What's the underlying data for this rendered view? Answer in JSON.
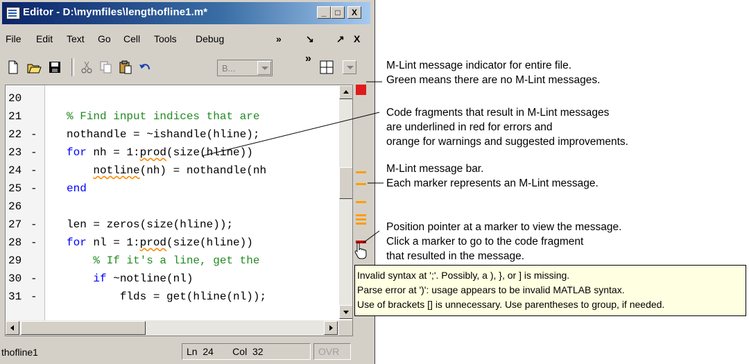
{
  "window": {
    "title": "Editor - D:\\mymfiles\\lengthofline1.m*",
    "buttons": {
      "minimize": "_",
      "maximize": "□",
      "close": "X"
    }
  },
  "menubar": {
    "items": [
      "File",
      "Edit",
      "Text",
      "Go",
      "Cell",
      "Tools",
      "Debug"
    ],
    "overflow": "»",
    "dock": "↘",
    "undock": "↗",
    "close": "X"
  },
  "toolbar": {
    "icons": [
      "new-file-icon",
      "open-folder-icon",
      "save-icon",
      "cut-icon",
      "copy-icon",
      "paste-icon",
      "undo-icon"
    ],
    "stack_combo": "B...",
    "overflow": "»",
    "layout_icon": "grid-icon"
  },
  "editor": {
    "lines": [
      {
        "num": "20",
        "bp": "",
        "text": ""
      },
      {
        "num": "21",
        "bp": "",
        "text": "% Find input indices that are"
      },
      {
        "num": "22",
        "bp": "-",
        "text": "nothandle = ~ishandle(hline);"
      },
      {
        "num": "23",
        "bp": "-",
        "kw": "for",
        "text": " nh = 1:prod(size(hline))"
      },
      {
        "num": "24",
        "bp": "-",
        "text": "    notline(nh) = nothandle(nh"
      },
      {
        "num": "25",
        "bp": "-",
        "kw": "end",
        "text": ""
      },
      {
        "num": "26",
        "bp": "",
        "text": ""
      },
      {
        "num": "27",
        "bp": "-",
        "text": "len = zeros(size(hline));"
      },
      {
        "num": "28",
        "bp": "-",
        "kw": "for",
        "text": " nl = 1:prod(size(hline))"
      },
      {
        "num": "29",
        "bp": "",
        "text": "    % If it's a line, get the"
      },
      {
        "num": "30",
        "bp": "-",
        "kw": "    if",
        "text": " ~notline(nl)"
      },
      {
        "num": "31",
        "bp": "-",
        "text": "        flds = get(hline(nl));"
      }
    ]
  },
  "mlint": {
    "indicator_color": "#e01b1b",
    "marker_color": "#ff9d00",
    "error_color": "#c00000"
  },
  "statusbar": {
    "filename": "thofline1",
    "ln_label": "Ln",
    "ln_value": "24",
    "col_label": "Col",
    "col_value": "32",
    "mode": "OVR"
  },
  "tooltip": {
    "lines": [
      "Invalid syntax at ';'. Possibly, a ), }, or ] is missing.",
      "Parse error at ')': usage appears to be invalid MATLAB syntax.",
      "Use of brackets [] is unnecessary. Use parentheses to group, if needed."
    ]
  },
  "annotations": {
    "indicator": [
      "M-Lint message indicator for entire file.",
      "Green means there are no M-Lint messages."
    ],
    "fragments": [
      "Code fragments that result in M-Lint messages",
      "are underlined in red for errors and",
      "orange for warnings and suggested improvements."
    ],
    "bar": [
      "M-Lint message bar.",
      "Each marker represents an M-Lint message."
    ],
    "pointer": [
      "Position pointer at a marker to view the message.",
      "Click a marker to go to the code fragment",
      "that resulted in the message."
    ]
  }
}
